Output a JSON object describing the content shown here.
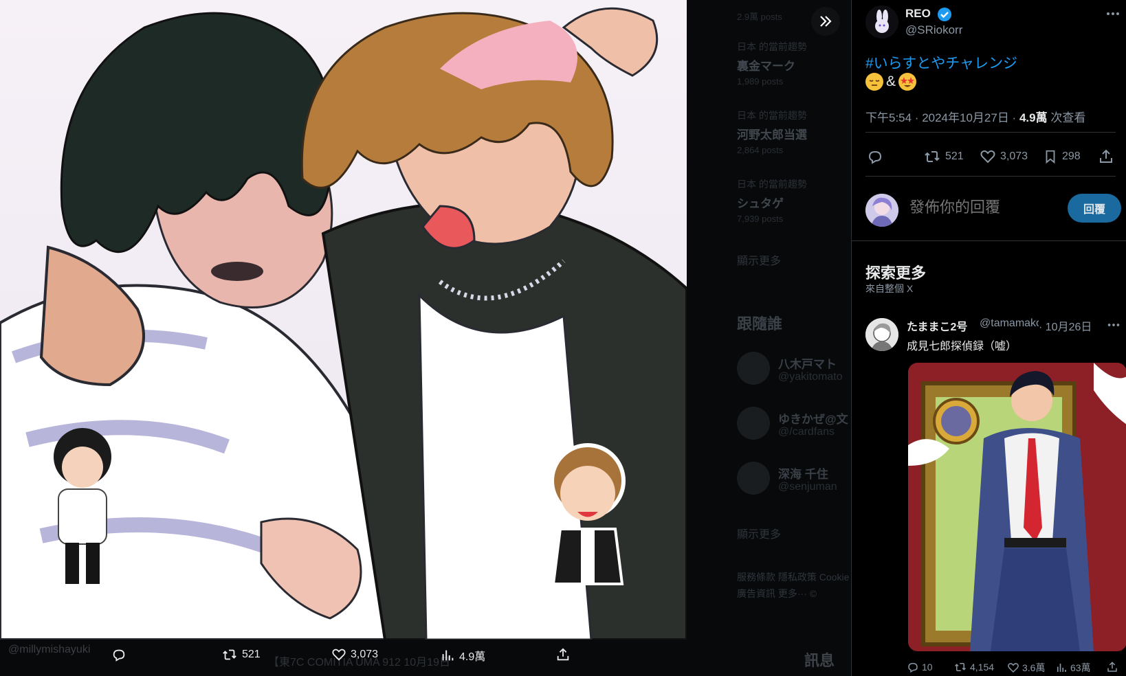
{
  "background_page": {
    "trends": [
      {
        "meta": "",
        "name": "",
        "count": "2.9萬 posts"
      },
      {
        "meta": "日本 的當前趨勢",
        "name": "裏金マーク",
        "count": "1,989 posts"
      },
      {
        "meta": "日本 的當前趨勢",
        "name": "河野太郎当選",
        "count": "2,864 posts"
      },
      {
        "meta": "日本 的當前趨勢",
        "name": "シュタゲ",
        "count": "7,939 posts"
      }
    ],
    "show_more": "顯示更多",
    "who_to_follow": "跟隨誰",
    "follow_suggestions": [
      {
        "name": "八木戸マト",
        "handle": "@yakitomato"
      },
      {
        "name": "ゆきかぜ@文",
        "handle": "@/cardfans"
      },
      {
        "name": "深海 千住",
        "handle": "@senjuman"
      }
    ],
    "show_more_2": "顯示更多",
    "footer_links": "服務條款  隱私政策  Cookie",
    "footer_links_2": "廣告資訊  更多···  ©",
    "messages": "訊息",
    "bg_tweet": "【東7C COMITIA UMA 912 10月19日"
  },
  "viewer": {
    "watermark": "@millymishayuki",
    "actions": {
      "reply_count": "",
      "retweet_count": "521",
      "like_count": "3,073",
      "view_count": "4.9萬"
    }
  },
  "tweet": {
    "author_name": "REO",
    "author_handle": "@SRiokorr",
    "hashtag": "#いらすとやチャレンジ",
    "emoji_text": "&",
    "time": "下午5:54 · 2024年10月27日 · ",
    "views_number": "4.9萬",
    "views_label": " 次查看",
    "stats": {
      "retweets": "521",
      "likes": "3,073",
      "bookmarks": "298"
    },
    "reply_placeholder": "發佈你的回覆",
    "reply_button": "回覆"
  },
  "explore": {
    "title": "探索更多",
    "subtitle": "來自整個 X",
    "tweet": {
      "name": "たままこ2号",
      "handle": "@tamamako",
      "date": "· 10月26日",
      "text": "成見七郎探偵録（嘘）",
      "stats": {
        "replies": "10",
        "retweets": "4,154",
        "likes": "3.6萬",
        "views": "63萬"
      }
    }
  },
  "colors": {
    "accent": "#1d9bf0",
    "background": "#000000",
    "secondary_text": "#8b98a5"
  }
}
